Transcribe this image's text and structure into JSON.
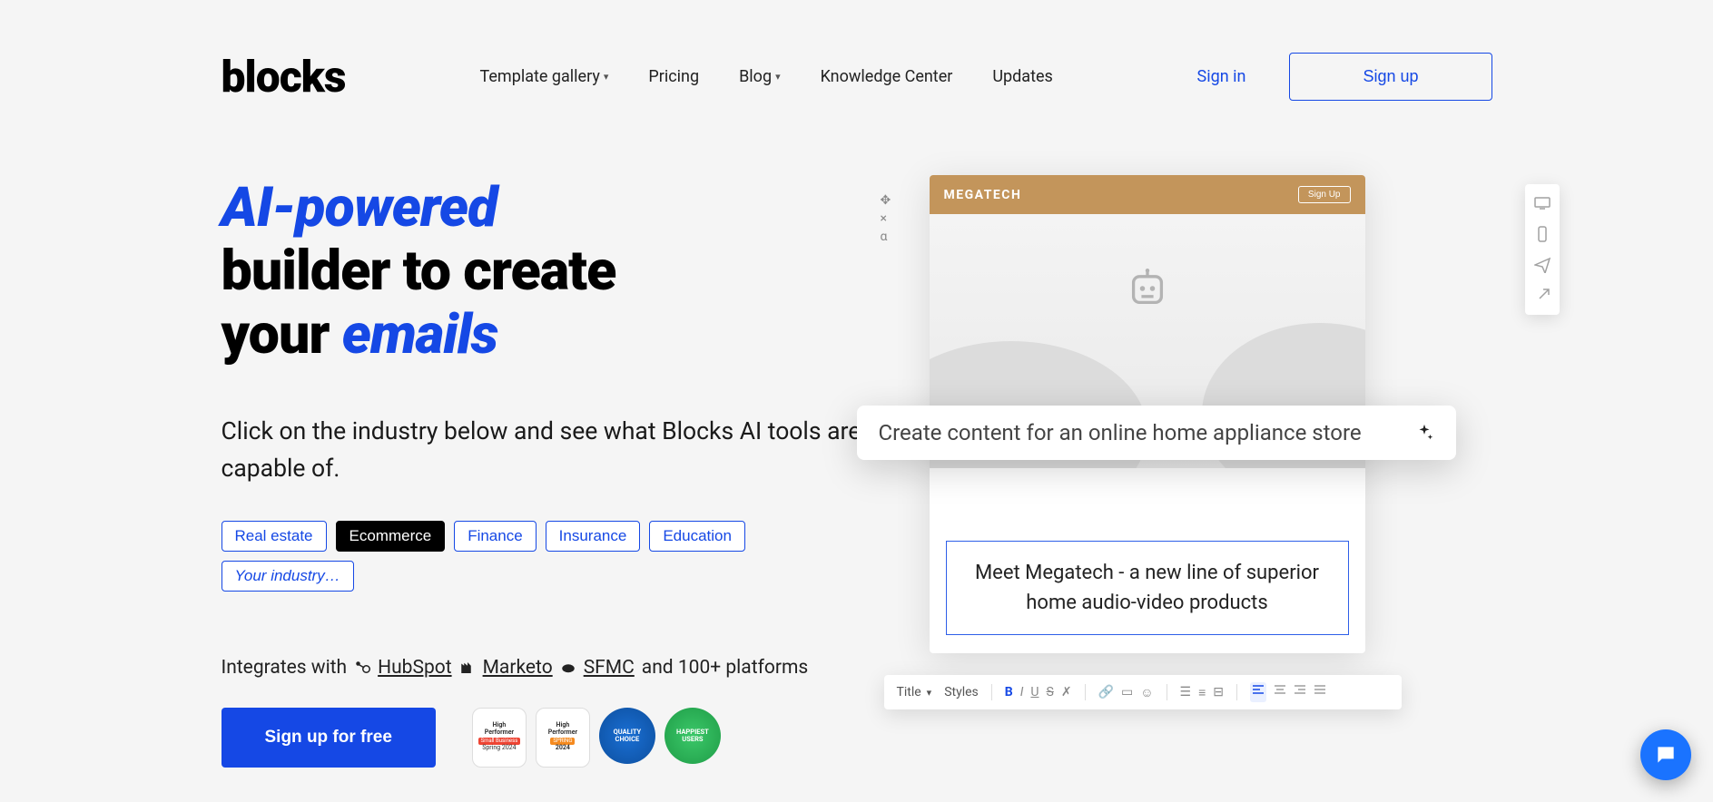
{
  "logo": "blocks",
  "nav": {
    "template_gallery": "Template gallery",
    "pricing": "Pricing",
    "blog": "Blog",
    "knowledge": "Knowledge Center",
    "updates": "Updates",
    "signin": "Sign in",
    "signup": "Sign up"
  },
  "hero": {
    "h_blue1": "AI-powered",
    "h_line2": "builder to create",
    "h_line3a": "your ",
    "h_blue2": "emails",
    "subtitle": "Click on the industry below and see what Blocks AI tools are capable of."
  },
  "tags": {
    "real_estate": "Real estate",
    "ecommerce": "Ecommerce",
    "finance": "Finance",
    "insurance": "Insurance",
    "education": "Education",
    "your_industry": "Your industry…"
  },
  "integrates": {
    "prefix": "Integrates with",
    "hubspot": "HubSpot",
    "marketo": "Marketo",
    "sfmc": "SFMC",
    "suffix": "and 100+ platforms"
  },
  "cta": {
    "signup_free": "Sign up for free"
  },
  "badges": {
    "hp1_l1": "High",
    "hp1_l2": "Performer",
    "hp1_ribbon": "Small Business",
    "hp1_year": "Spring 2024",
    "hp2_l1": "High",
    "hp2_l2": "Performer",
    "hp2_ribbon": "SPRING",
    "hp2_year": "2024",
    "quality_l1": "QUALITY",
    "quality_l2": "CHOICE",
    "happy_l1": "HAPPIEST",
    "happy_l2": "USERS"
  },
  "preview": {
    "brand": "MEGATECH",
    "signup": "Sign Up",
    "ai_prompt": "Create content for an online home appliance store",
    "text_block": "Meet Megatech - a new line of superior home audio-video products"
  },
  "toolbar": {
    "title": "Title",
    "styles": "Styles"
  }
}
